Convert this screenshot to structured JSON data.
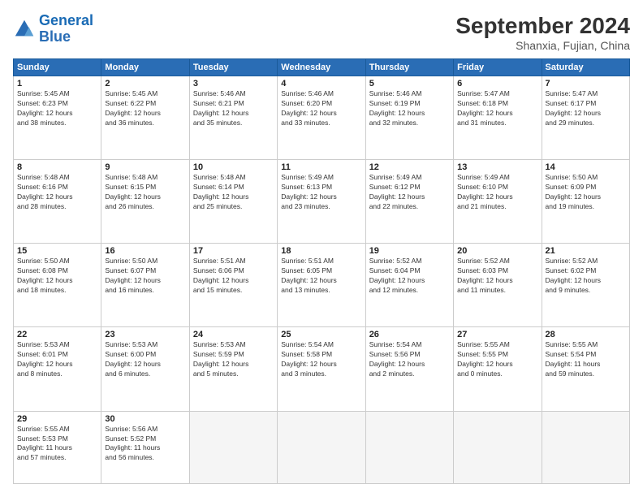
{
  "logo": {
    "line1": "General",
    "line2": "Blue"
  },
  "title": "September 2024",
  "subtitle": "Shanxia, Fujian, China",
  "weekdays": [
    "Sunday",
    "Monday",
    "Tuesday",
    "Wednesday",
    "Thursday",
    "Friday",
    "Saturday"
  ],
  "weeks": [
    [
      {
        "day": "1",
        "info": "Sunrise: 5:45 AM\nSunset: 6:23 PM\nDaylight: 12 hours\nand 38 minutes."
      },
      {
        "day": "2",
        "info": "Sunrise: 5:45 AM\nSunset: 6:22 PM\nDaylight: 12 hours\nand 36 minutes."
      },
      {
        "day": "3",
        "info": "Sunrise: 5:46 AM\nSunset: 6:21 PM\nDaylight: 12 hours\nand 35 minutes."
      },
      {
        "day": "4",
        "info": "Sunrise: 5:46 AM\nSunset: 6:20 PM\nDaylight: 12 hours\nand 33 minutes."
      },
      {
        "day": "5",
        "info": "Sunrise: 5:46 AM\nSunset: 6:19 PM\nDaylight: 12 hours\nand 32 minutes."
      },
      {
        "day": "6",
        "info": "Sunrise: 5:47 AM\nSunset: 6:18 PM\nDaylight: 12 hours\nand 31 minutes."
      },
      {
        "day": "7",
        "info": "Sunrise: 5:47 AM\nSunset: 6:17 PM\nDaylight: 12 hours\nand 29 minutes."
      }
    ],
    [
      {
        "day": "8",
        "info": "Sunrise: 5:48 AM\nSunset: 6:16 PM\nDaylight: 12 hours\nand 28 minutes."
      },
      {
        "day": "9",
        "info": "Sunrise: 5:48 AM\nSunset: 6:15 PM\nDaylight: 12 hours\nand 26 minutes."
      },
      {
        "day": "10",
        "info": "Sunrise: 5:48 AM\nSunset: 6:14 PM\nDaylight: 12 hours\nand 25 minutes."
      },
      {
        "day": "11",
        "info": "Sunrise: 5:49 AM\nSunset: 6:13 PM\nDaylight: 12 hours\nand 23 minutes."
      },
      {
        "day": "12",
        "info": "Sunrise: 5:49 AM\nSunset: 6:12 PM\nDaylight: 12 hours\nand 22 minutes."
      },
      {
        "day": "13",
        "info": "Sunrise: 5:49 AM\nSunset: 6:10 PM\nDaylight: 12 hours\nand 21 minutes."
      },
      {
        "day": "14",
        "info": "Sunrise: 5:50 AM\nSunset: 6:09 PM\nDaylight: 12 hours\nand 19 minutes."
      }
    ],
    [
      {
        "day": "15",
        "info": "Sunrise: 5:50 AM\nSunset: 6:08 PM\nDaylight: 12 hours\nand 18 minutes."
      },
      {
        "day": "16",
        "info": "Sunrise: 5:50 AM\nSunset: 6:07 PM\nDaylight: 12 hours\nand 16 minutes."
      },
      {
        "day": "17",
        "info": "Sunrise: 5:51 AM\nSunset: 6:06 PM\nDaylight: 12 hours\nand 15 minutes."
      },
      {
        "day": "18",
        "info": "Sunrise: 5:51 AM\nSunset: 6:05 PM\nDaylight: 12 hours\nand 13 minutes."
      },
      {
        "day": "19",
        "info": "Sunrise: 5:52 AM\nSunset: 6:04 PM\nDaylight: 12 hours\nand 12 minutes."
      },
      {
        "day": "20",
        "info": "Sunrise: 5:52 AM\nSunset: 6:03 PM\nDaylight: 12 hours\nand 11 minutes."
      },
      {
        "day": "21",
        "info": "Sunrise: 5:52 AM\nSunset: 6:02 PM\nDaylight: 12 hours\nand 9 minutes."
      }
    ],
    [
      {
        "day": "22",
        "info": "Sunrise: 5:53 AM\nSunset: 6:01 PM\nDaylight: 12 hours\nand 8 minutes."
      },
      {
        "day": "23",
        "info": "Sunrise: 5:53 AM\nSunset: 6:00 PM\nDaylight: 12 hours\nand 6 minutes."
      },
      {
        "day": "24",
        "info": "Sunrise: 5:53 AM\nSunset: 5:59 PM\nDaylight: 12 hours\nand 5 minutes."
      },
      {
        "day": "25",
        "info": "Sunrise: 5:54 AM\nSunset: 5:58 PM\nDaylight: 12 hours\nand 3 minutes."
      },
      {
        "day": "26",
        "info": "Sunrise: 5:54 AM\nSunset: 5:56 PM\nDaylight: 12 hours\nand 2 minutes."
      },
      {
        "day": "27",
        "info": "Sunrise: 5:55 AM\nSunset: 5:55 PM\nDaylight: 12 hours\nand 0 minutes."
      },
      {
        "day": "28",
        "info": "Sunrise: 5:55 AM\nSunset: 5:54 PM\nDaylight: 11 hours\nand 59 minutes."
      }
    ],
    [
      {
        "day": "29",
        "info": "Sunrise: 5:55 AM\nSunset: 5:53 PM\nDaylight: 11 hours\nand 57 minutes."
      },
      {
        "day": "30",
        "info": "Sunrise: 5:56 AM\nSunset: 5:52 PM\nDaylight: 11 hours\nand 56 minutes."
      },
      {
        "day": "",
        "info": ""
      },
      {
        "day": "",
        "info": ""
      },
      {
        "day": "",
        "info": ""
      },
      {
        "day": "",
        "info": ""
      },
      {
        "day": "",
        "info": ""
      }
    ]
  ]
}
